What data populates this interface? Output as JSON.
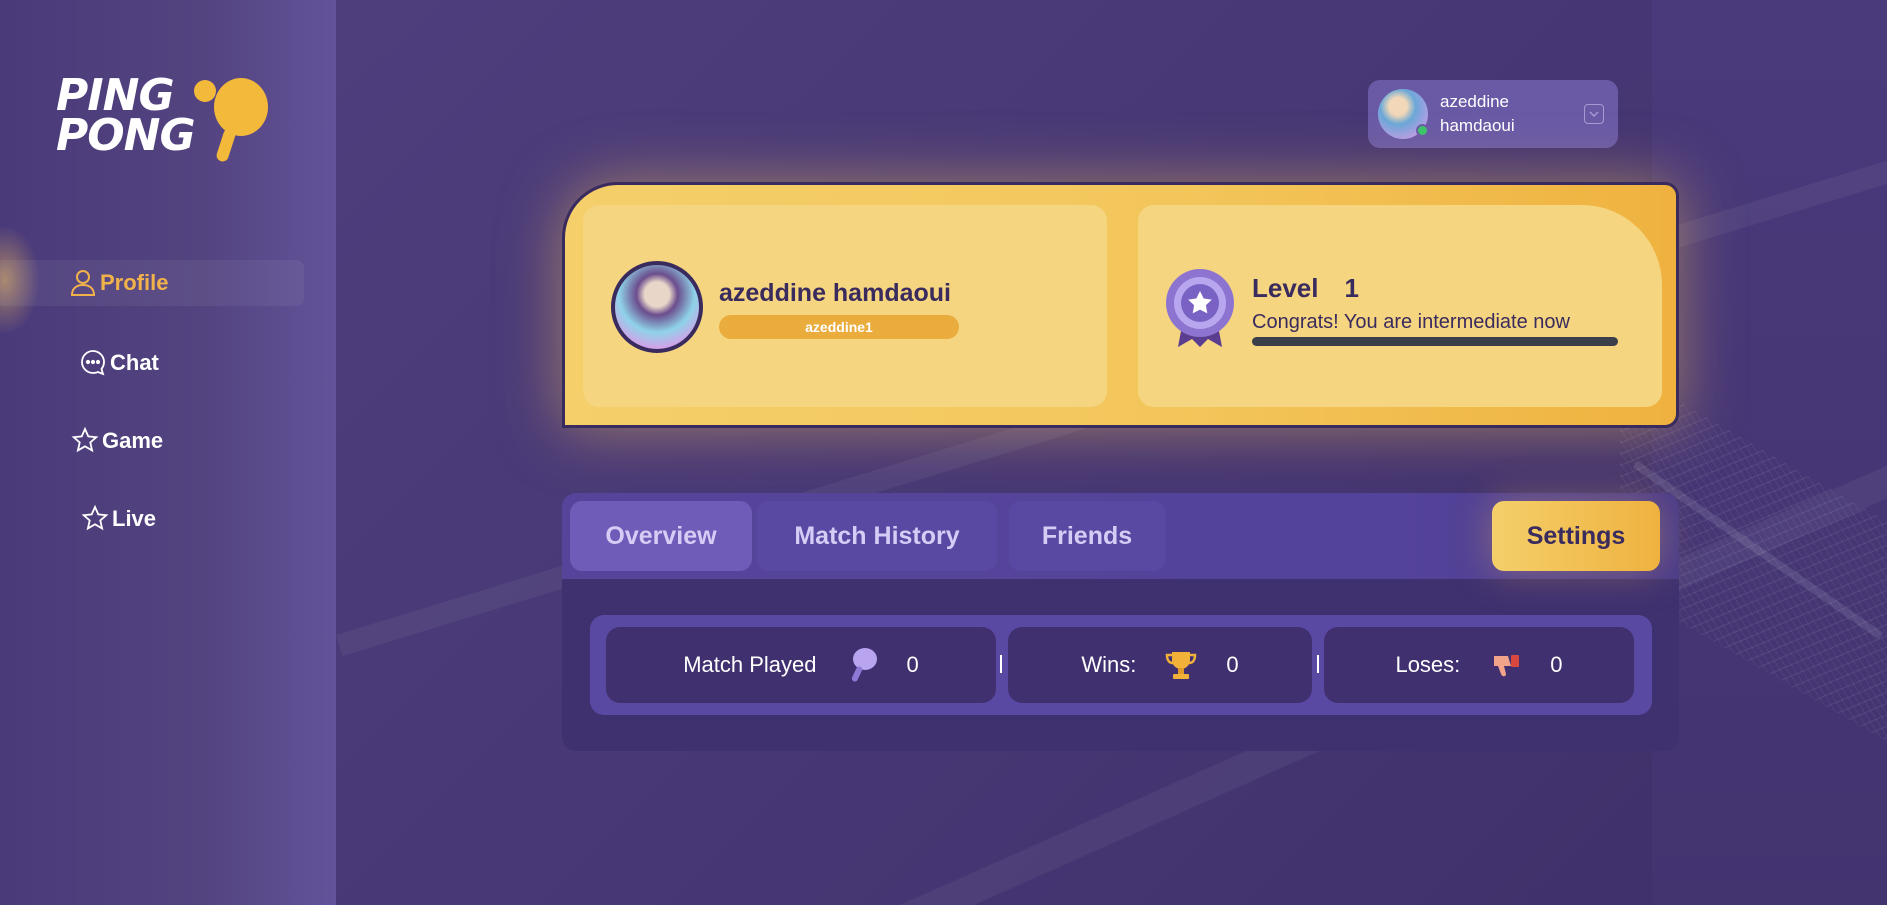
{
  "app": {
    "logo_line1": "PING",
    "logo_line2": "PONG",
    "accent_color": "#f2b24a",
    "bg_color": "#4b3a7d"
  },
  "sidebar": {
    "items": [
      {
        "label": "Profile",
        "icon": "user-icon",
        "active": true
      },
      {
        "label": "Chat",
        "icon": "chat-bubble-icon",
        "active": false
      },
      {
        "label": "Game",
        "icon": "star-icon",
        "active": false
      },
      {
        "label": "Live",
        "icon": "star-icon",
        "active": false
      }
    ]
  },
  "header": {
    "user": {
      "first_name": "azeddine",
      "last_name": "hamdaoui",
      "status": "online",
      "menu_icon": "chevron-down-icon"
    }
  },
  "profile": {
    "full_name": "azeddine hamdaoui",
    "username": "azeddine1",
    "level_label": "Level",
    "level_value": "1",
    "level_message": "Congrats! You are intermediate now",
    "level_progress": 0,
    "badge_icon": "ribbon-badge-icon"
  },
  "tabs": {
    "items": [
      {
        "label": "Overview",
        "active": true
      },
      {
        "label": "Match History",
        "active": false
      },
      {
        "label": "Friends",
        "active": false
      }
    ],
    "settings_label": "Settings"
  },
  "stats": {
    "match_played_label": "Match Played",
    "match_played_value": "0",
    "wins_label": "Wins:",
    "wins_value": "0",
    "loses_label": "Loses:",
    "loses_value": "0",
    "separator": "|"
  }
}
